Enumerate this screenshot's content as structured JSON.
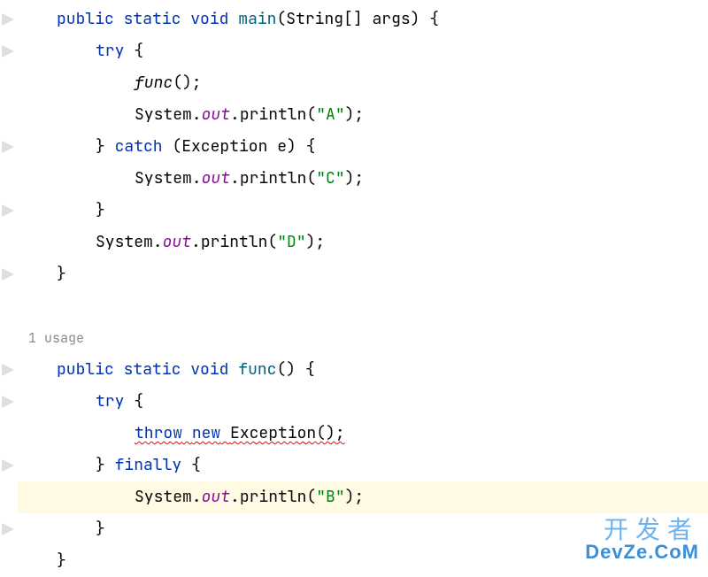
{
  "code": {
    "main": {
      "signature": {
        "public": "public",
        "static": "static",
        "void": "void",
        "name": "main",
        "params_open": "(String[] args) {"
      },
      "try_open": "try",
      "brace_open": " {",
      "func_call": "func",
      "func_call_suffix": "();",
      "sysout1": {
        "system": "System.",
        "out": "out",
        "println": ".println(",
        "arg": "\"A\"",
        "end": ");"
      },
      "catch": {
        "close_try": "} ",
        "kw": "catch",
        "params": " (Exception e) {"
      },
      "sysout2": {
        "system": "System.",
        "out": "out",
        "println": ".println(",
        "arg": "\"C\"",
        "end": ");"
      },
      "close_catch": "}",
      "sysout3": {
        "system": "System.",
        "out": "out",
        "println": ".println(",
        "arg": "\"D\"",
        "end": ");"
      },
      "close_method": "}"
    },
    "usage_hint": "1 usage",
    "func": {
      "signature": {
        "public": "public",
        "static": "static",
        "void": "void",
        "name": "func",
        "params_open": "() {"
      },
      "try_open": "try",
      "brace_open": " {",
      "throw_line": {
        "throw": "throw",
        "new": "new",
        "space": " ",
        "exception": "Exception();"
      },
      "finally": {
        "close_try": "} ",
        "kw": "finally",
        "brace": " {"
      },
      "sysout": {
        "system": "System.",
        "out": "out",
        "println": ".println(",
        "arg": "\"B\"",
        "end": ");"
      },
      "close_finally": "}",
      "close_method": "}"
    }
  },
  "watermark": {
    "top": "开发者",
    "bottom": "DevZe.CoM"
  }
}
